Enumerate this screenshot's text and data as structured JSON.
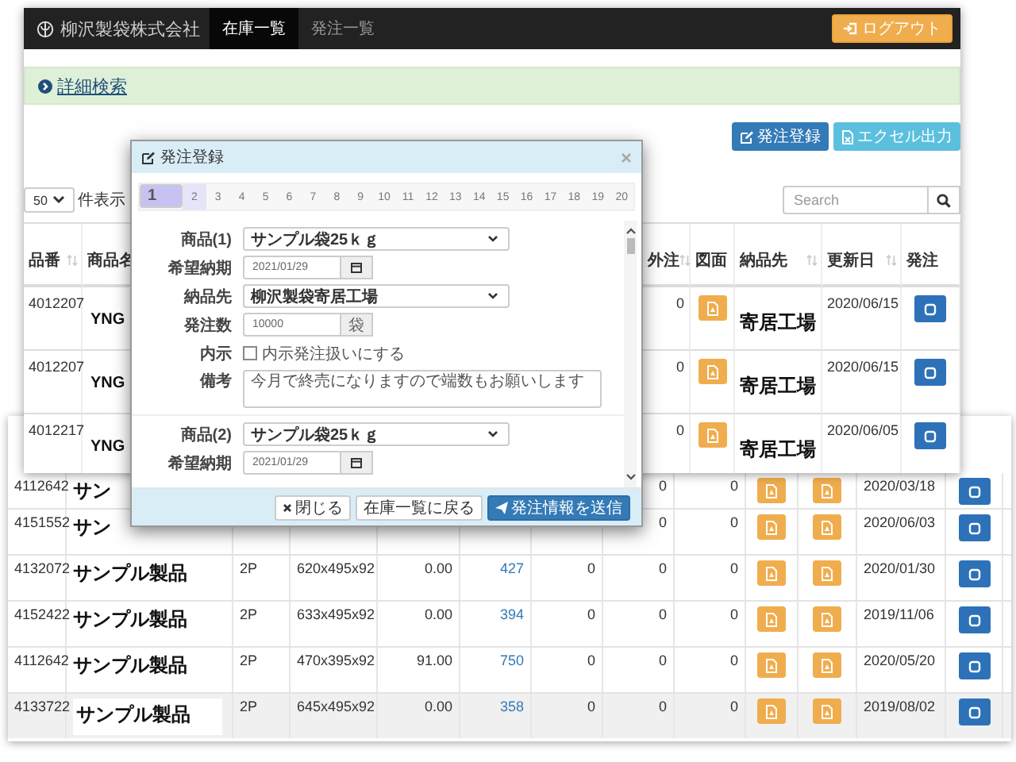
{
  "navbar": {
    "brand": "柳沢製袋株式会社",
    "tabs": [
      {
        "label": "在庫一覧",
        "selected": true
      },
      {
        "label": "発注一覧",
        "selected": false
      }
    ],
    "logout": "ログアウト"
  },
  "search_panel": {
    "link": "詳細検索"
  },
  "actions": [
    {
      "label": "発注登録",
      "kind": "primary"
    },
    {
      "label": "エクセル出力",
      "kind": "info"
    }
  ],
  "page_size": {
    "value": "50",
    "label": "件表示"
  },
  "search": {
    "placeholder": "Search"
  },
  "table": {
    "columns": [
      {
        "label": "品番",
        "sortable": true
      },
      {
        "label": "商品名",
        "sortable": false
      },
      {
        "label": "外注",
        "sortable": true
      },
      {
        "label": "図面",
        "sortable": false
      },
      {
        "label": "納品先",
        "sortable": true
      },
      {
        "label": "更新日",
        "sortable": true
      },
      {
        "label": "発注",
        "sortable": false
      }
    ],
    "rows": [
      {
        "code": "4012207",
        "name": "YNG",
        "outsourced": "0",
        "destination": "寄居工場",
        "updated": "2020/06/15"
      },
      {
        "code": "4012207",
        "name": "YNG",
        "outsourced": "0",
        "destination": "寄居工場",
        "updated": "2020/06/15"
      },
      {
        "code": "4012217",
        "name": "YNG",
        "outsourced": "0",
        "destination": "寄居工場",
        "updated": "2020/06/05"
      }
    ]
  },
  "dialog": {
    "title": "発注登録",
    "pages": [
      {
        "label": "1",
        "selected": true,
        "highlighted": false
      },
      {
        "label": "2",
        "selected": false,
        "highlighted": true
      },
      {
        "label": "3",
        "selected": false,
        "highlighted": false
      },
      {
        "label": "4",
        "selected": false,
        "highlighted": false
      },
      {
        "label": "5",
        "selected": false,
        "highlighted": false
      },
      {
        "label": "6",
        "selected": false,
        "highlighted": false
      },
      {
        "label": "7",
        "selected": false,
        "highlighted": false
      },
      {
        "label": "8",
        "selected": false,
        "highlighted": false
      },
      {
        "label": "9",
        "selected": false,
        "highlighted": false
      },
      {
        "label": "10",
        "selected": false,
        "highlighted": false
      },
      {
        "label": "11",
        "selected": false,
        "highlighted": false
      },
      {
        "label": "12",
        "selected": false,
        "highlighted": false
      },
      {
        "label": "13",
        "selected": false,
        "highlighted": false
      },
      {
        "label": "14",
        "selected": false,
        "highlighted": false
      },
      {
        "label": "15",
        "selected": false,
        "highlighted": false
      },
      {
        "label": "16",
        "selected": false,
        "highlighted": false
      },
      {
        "label": "17",
        "selected": false,
        "highlighted": false
      },
      {
        "label": "18",
        "selected": false,
        "highlighted": false
      },
      {
        "label": "19",
        "selected": false,
        "highlighted": false
      },
      {
        "label": "20",
        "selected": false,
        "highlighted": false
      }
    ],
    "groups": [
      {
        "fields": [
          {
            "kind": "select",
            "label": "商品(1)",
            "value": "サンプル袋25ｋｇ"
          },
          {
            "kind": "date",
            "label": "希望納期",
            "value": "2021/01/29"
          },
          {
            "kind": "select",
            "label": "納品先",
            "value": "柳沢製袋寄居工場"
          },
          {
            "kind": "addon",
            "label": "発注数",
            "value": "10000",
            "unit": "袋"
          },
          {
            "kind": "checkbox",
            "label": "内示",
            "text": "内示発注扱いにする",
            "checked": false
          },
          {
            "kind": "textarea",
            "label": "備考",
            "value": "今月で終売になりますので端数もお願いします"
          }
        ]
      },
      {
        "fields": [
          {
            "kind": "select",
            "label": "商品(2)",
            "value": "サンプル袋25ｋｇ"
          },
          {
            "kind": "date",
            "label": "希望納期",
            "value": "2021/01/29"
          }
        ]
      }
    ],
    "buttons": [
      {
        "label": "閉じる",
        "kind": "close"
      },
      {
        "label": "在庫一覧に戻る",
        "kind": "default"
      },
      {
        "label": "発注情報を送信",
        "kind": "send"
      }
    ]
  },
  "back_table": {
    "rows": [
      {
        "column_1": "4112642",
        "column_2": "サン",
        "column_8": "0",
        "column_9": "0",
        "column_12": "2020/03/18",
        "highlighted": false
      },
      {
        "column_1": "4151552",
        "column_2": "サン",
        "column_8": "0",
        "column_9": "0",
        "column_12": "2020/06/03",
        "highlighted": false
      },
      {
        "column_1": "4132072",
        "column_2": "サンプル製品",
        "column_3": "2P",
        "column_4": "620x495x92",
        "column_5": "0.00",
        "column_6": "427",
        "column_7": "0",
        "column_8": "0",
        "column_9": "0",
        "column_12": "2020/01/30",
        "highlighted": false
      },
      {
        "column_1": "4152422",
        "column_2": "サンプル製品",
        "column_3": "2P",
        "column_4": "633x495x92",
        "column_5": "0.00",
        "column_6": "394",
        "column_7": "0",
        "column_8": "0",
        "column_9": "0",
        "column_12": "2019/11/06",
        "highlighted": false
      },
      {
        "column_1": "4112642",
        "column_2": "サンプル製品",
        "column_3": "2P",
        "column_4": "470x395x92",
        "column_5": "91.00",
        "column_6": "750",
        "column_7": "0",
        "column_8": "0",
        "column_9": "0",
        "column_12": "2020/05/20",
        "highlighted": false
      },
      {
        "column_1": "4133722",
        "column_2": "サンプル製品",
        "column_3": "2P",
        "column_4": "645x495x92",
        "column_5": "0.00",
        "column_6": "358",
        "column_7": "0",
        "column_8": "0",
        "column_9": "0",
        "column_12": "2019/08/02",
        "highlighted": true
      }
    ]
  }
}
